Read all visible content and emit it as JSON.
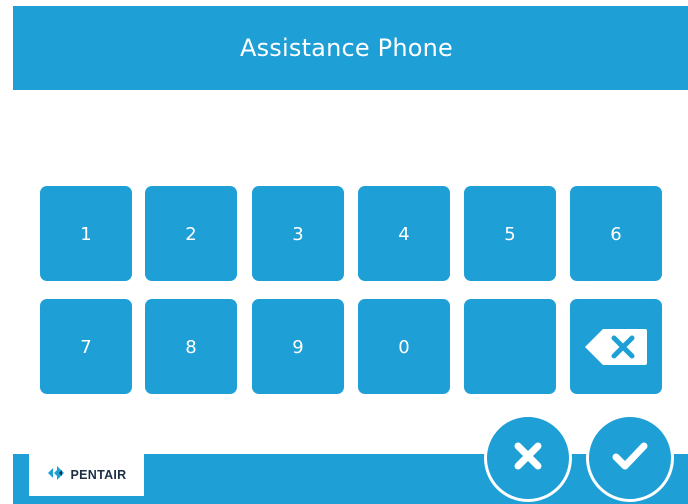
{
  "header": {
    "title": "Assistance Phone"
  },
  "phone_display": {
    "value": ""
  },
  "keypad": {
    "keys": [
      {
        "label": "1"
      },
      {
        "label": "2"
      },
      {
        "label": "3"
      },
      {
        "label": "4"
      },
      {
        "label": "5"
      },
      {
        "label": "6"
      },
      {
        "label": "7"
      },
      {
        "label": "8"
      },
      {
        "label": "9"
      },
      {
        "label": "0"
      },
      {
        "label": ""
      }
    ],
    "backspace_icon": "backspace-icon"
  },
  "footer": {
    "logo_text": "PENTAIR",
    "cancel_icon": "close-icon",
    "confirm_icon": "checkmark-icon"
  },
  "colors": {
    "accent": "#1e9fd6",
    "background": "#ffffff",
    "logo_text": "#1d2f45"
  }
}
